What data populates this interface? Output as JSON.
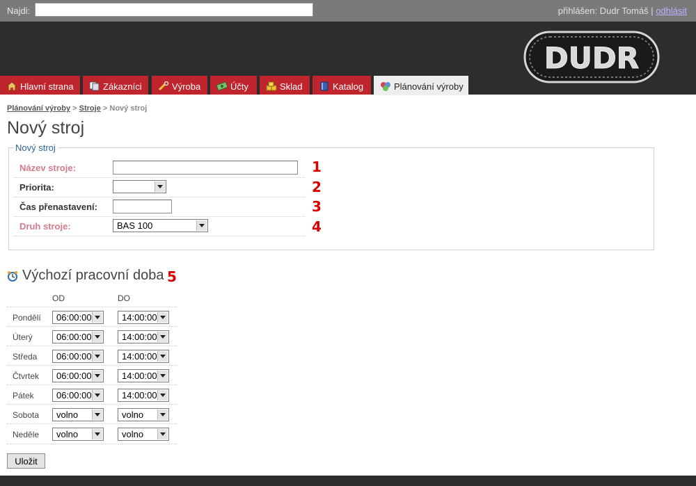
{
  "search": {
    "label": "Najdi:",
    "value": ""
  },
  "user": {
    "logged_in_text": "přihlášen: Dudr Tomáš",
    "separator": " | ",
    "logout": "odhlásit"
  },
  "logo": {
    "text": "DUDR"
  },
  "tabs": [
    {
      "label": "Hlavní strana",
      "icon": "home-icon",
      "active": false
    },
    {
      "label": "Zákazníci",
      "icon": "customers-icon",
      "active": false
    },
    {
      "label": "Výroba",
      "icon": "tools-icon",
      "active": false
    },
    {
      "label": "Účty",
      "icon": "money-icon",
      "active": false
    },
    {
      "label": "Sklad",
      "icon": "boxes-icon",
      "active": false
    },
    {
      "label": "Katalog",
      "icon": "book-icon",
      "active": false
    },
    {
      "label": "Plánování výroby",
      "icon": "planning-icon",
      "active": true
    }
  ],
  "breadcrumb": {
    "item1": "Plánování výroby",
    "sep": " > ",
    "item2": "Stroje",
    "current": "Nový stroj"
  },
  "page_title": "Nový stroj",
  "form": {
    "legend": "Nový stroj",
    "fields": {
      "name": {
        "label": "Název stroje:",
        "value": "",
        "marker": "1"
      },
      "priority": {
        "label": "Priorita:",
        "value": "",
        "marker": "2"
      },
      "setup_time": {
        "label": "Čas přenastavení:",
        "value": "",
        "marker": "3"
      },
      "machine_type": {
        "label": "Druh stroje:",
        "value": "BAS 100",
        "marker": "4"
      }
    }
  },
  "schedule": {
    "title": "Výchozí pracovní doba",
    "marker": "5",
    "col_from": "OD",
    "col_to": "DO",
    "rows": [
      {
        "day": "Pondělí",
        "from": "06:00:00",
        "to": "14:00:00"
      },
      {
        "day": "Úterý",
        "from": "06:00:00",
        "to": "14:00:00"
      },
      {
        "day": "Středa",
        "from": "06:00:00",
        "to": "14:00:00"
      },
      {
        "day": "Čtvrtek",
        "from": "06:00:00",
        "to": "14:00:00"
      },
      {
        "day": "Pátek",
        "from": "06:00:00",
        "to": "14:00:00"
      },
      {
        "day": "Sobota",
        "from": "volno",
        "to": "volno"
      },
      {
        "day": "Neděle",
        "from": "volno",
        "to": "volno"
      }
    ]
  },
  "save_label": "Uložit",
  "colors": {
    "tab_red": "#c0252e",
    "header_dark": "#2c2e2e",
    "required_label": "#d27b8b",
    "marker_red": "#d90000"
  }
}
